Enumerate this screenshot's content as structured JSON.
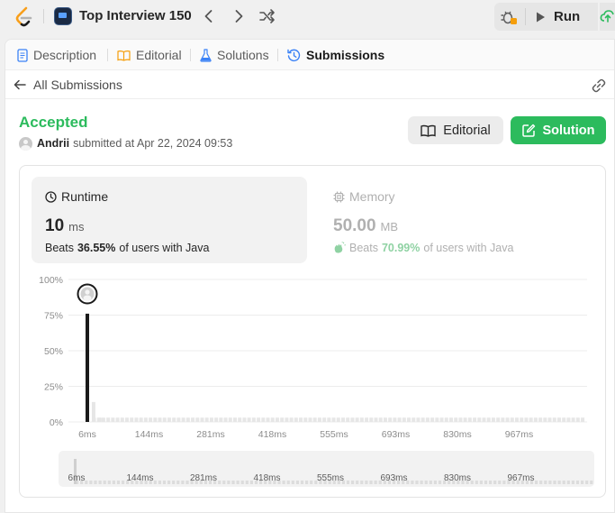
{
  "topbar": {
    "list_title": "Top Interview 150",
    "run_label": "Run",
    "icons": [
      "leetcode-logo-icon",
      "study-plan-icon",
      "chevron-left-icon",
      "chevron-right-icon",
      "shuffle-icon",
      "debug-icon",
      "play-icon",
      "upload-cloud-icon"
    ]
  },
  "tabs": [
    {
      "label": "Description",
      "icon": "description-icon",
      "color": "#3b82f6"
    },
    {
      "label": "Editorial",
      "icon": "book-icon",
      "color": "#f59e0b"
    },
    {
      "label": "Solutions",
      "icon": "flask-icon",
      "color": "#3b82f6"
    },
    {
      "label": "Submissions",
      "icon": "history-icon",
      "active": true,
      "color": "#3b82f6"
    }
  ],
  "subbar": {
    "back_label": "All Submissions"
  },
  "submission": {
    "status": "Accepted",
    "status_color": "#2cbb5d",
    "author": "Andrii",
    "submitted_text": "submitted at Apr 22, 2024 09:53"
  },
  "buttons": {
    "editorial": "Editorial",
    "solution": "Solution"
  },
  "runtime": {
    "label": "Runtime",
    "value": "10",
    "unit": "ms",
    "beats_prefix": "Beats",
    "beats_pct": "36.55%",
    "beats_suffix": "of users with Java"
  },
  "memory": {
    "label": "Memory",
    "value": "50.00",
    "unit": "MB",
    "beats_prefix": "Beats",
    "beats_pct": "70.99%",
    "beats_suffix": "of users with Java"
  },
  "chart_data": {
    "type": "bar",
    "y_ticks": [
      "100%",
      "75%",
      "50%",
      "25%",
      "0%"
    ],
    "ylim": [
      0,
      100
    ],
    "x_ticks": [
      "6ms",
      "144ms",
      "281ms",
      "418ms",
      "555ms",
      "693ms",
      "830ms",
      "967ms"
    ],
    "xlim": [
      6,
      1040
    ],
    "bars": [
      {
        "x": 6,
        "y": 76,
        "highlight": true
      },
      {
        "x": 10,
        "y": 14
      },
      {
        "x": 14,
        "y": 3
      }
    ],
    "tail_level": 3,
    "highlight_color": "#1a1a1a",
    "bar_color": "#e6e6e6",
    "marker_at_x": 6,
    "brush_ticks": [
      "6ms",
      "144ms",
      "281ms",
      "418ms",
      "555ms",
      "693ms",
      "830ms",
      "967ms"
    ]
  }
}
